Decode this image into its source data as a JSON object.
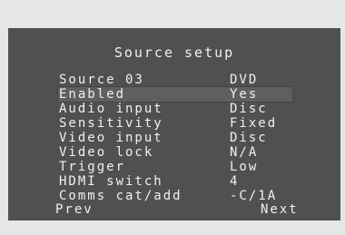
{
  "screen": {
    "title": "Source setup"
  },
  "menu": {
    "items": [
      {
        "label": "Source 03",
        "value": "DVD"
      },
      {
        "label": "Enabled",
        "value": "Yes"
      },
      {
        "label": "Audio input",
        "value": "Disc"
      },
      {
        "label": "Sensitivity",
        "value": "Fixed"
      },
      {
        "label": "Video input",
        "value": "Disc"
      },
      {
        "label": "Video lock",
        "value": "N/A"
      },
      {
        "label": "Trigger",
        "value": "Low"
      },
      {
        "label": "HDMI switch",
        "value": "4"
      },
      {
        "label": "Comms cat/add",
        "value": "-C/1A"
      }
    ],
    "selected_index": 1
  },
  "softkeys": {
    "prev": "Prev",
    "next": "Next"
  },
  "colors": {
    "screen_background": "#505050",
    "page_background": "#e6e6e6",
    "text": "#f0f0f0",
    "selection_bar": "#5f5f5f"
  }
}
